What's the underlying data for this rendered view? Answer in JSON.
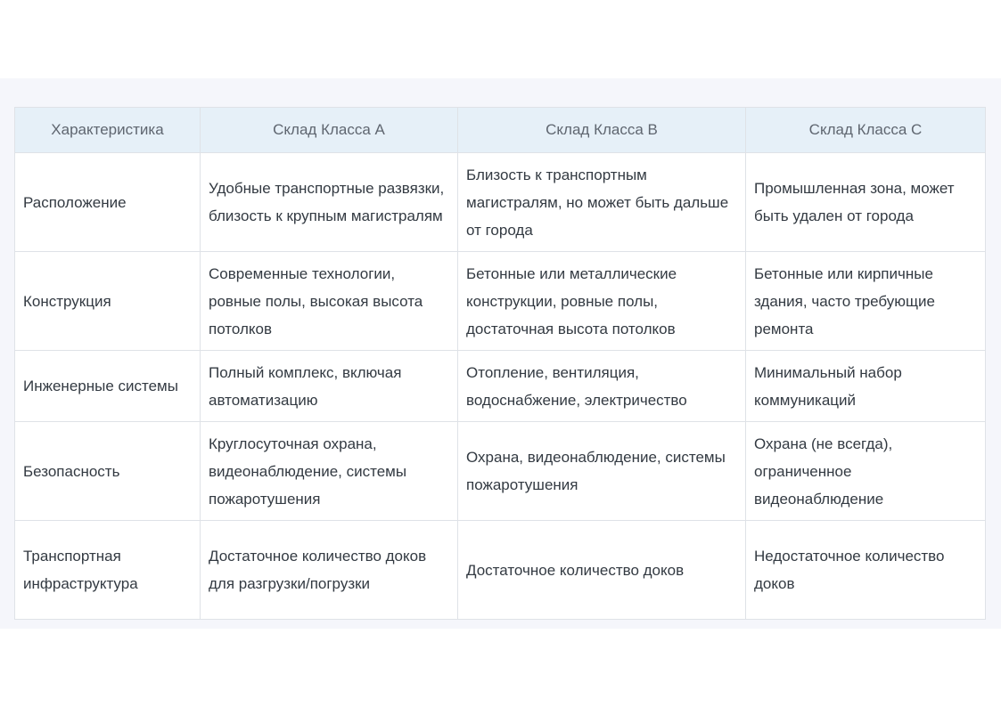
{
  "table": {
    "headers": [
      "Характеристика",
      "Склад Класса A",
      "Склад Класса B",
      "Склад Класса C"
    ],
    "rows": [
      {
        "feature": "Расположение",
        "class_a": "Удобные транспортные развязки, близость к крупным магистралям",
        "class_b": "Близость к транспортным магистралям, но может быть дальше от города",
        "class_c": "Промышленная зона, может быть удален от города"
      },
      {
        "feature": "Конструкция",
        "class_a": "Современные технологии, ровные полы, высокая высота потолков",
        "class_b": "Бетонные или металлические конструкции, ровные полы, достаточная высота потолков",
        "class_c": "Бетонные или кирпичные здания, часто требующие ремонта"
      },
      {
        "feature": "Инженерные системы",
        "class_a": "Полный комплекс, включая автоматизацию",
        "class_b": "Отопление, вентиляция, водоснабжение, электричество",
        "class_c": "Минимальный набор коммуникаций"
      },
      {
        "feature": "Безопасность",
        "class_a": "Круглосуточная охрана, видеонаблюдение, системы пожаротушения",
        "class_b": "Охрана, видеонаблюдение, системы пожаротушения",
        "class_c": "Охрана (не всегда), ограниченное видеонаблюдение"
      },
      {
        "feature": "Транспортная инфраструктура",
        "class_a": "Достаточное количество доков для разгрузки/погрузки",
        "class_b": "Достаточное количество доков",
        "class_c": "Недостаточное количество доков"
      }
    ]
  }
}
